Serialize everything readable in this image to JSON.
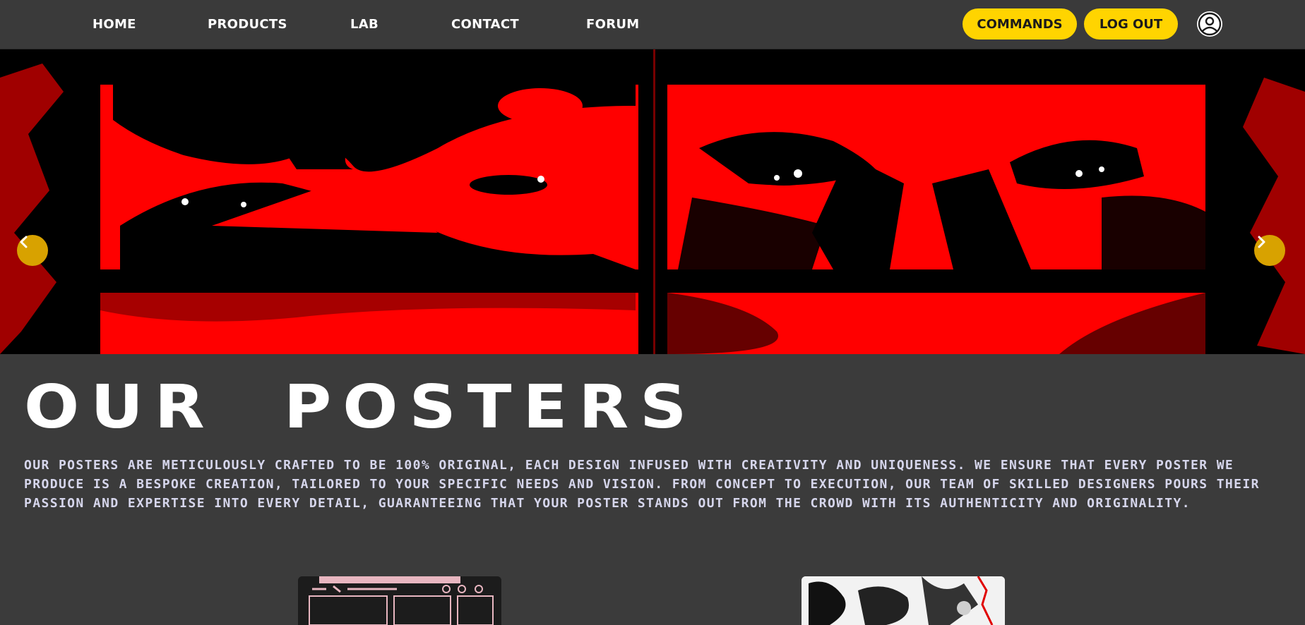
{
  "nav": {
    "links": [
      "HOME",
      "PRODUCTS",
      "LAB",
      "CONTACT",
      "FORUM"
    ],
    "commands_label": "COMMANDS",
    "logout_label": "LOG OUT",
    "user_icon": "user-circle-icon"
  },
  "hero": {
    "prev_icon": "chevron-left-icon",
    "next_icon": "chevron-right-icon"
  },
  "posters": {
    "title": "OUR  POSTERS",
    "description": "OUR POSTERS ARE METICULOUSLY CRAFTED TO BE 100% ORIGINAL, EACH DESIGN INFUSED WITH CREATIVITY AND UNIQUENESS. WE ENSURE THAT EVERY POSTER WE PRODUCE IS A BESPOKE CREATION, TAILORED TO YOUR SPECIFIC NEEDS AND VISION. FROM CONCEPT TO EXECUTION, OUR TEAM OF SKILLED DESIGNERS POURS THEIR PASSION AND EXPERTISE INTO EVERY DETAIL, GUARANTEEING THAT YOUR POSTER STANDS OUT FROM THE CROWD WITH ITS AUTHENTICITY AND ORIGINALITY."
  },
  "colors": {
    "background": "#3b3b3b",
    "accent": "#ffd400",
    "arrow": "#d8a200",
    "hero_red": "#ff0000"
  }
}
